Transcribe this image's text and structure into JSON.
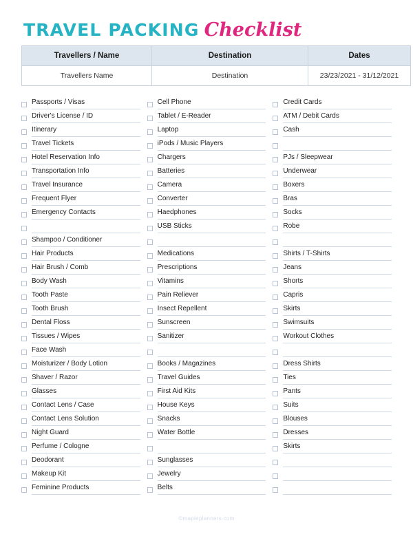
{
  "title": {
    "main": "TRAVEL PACKING",
    "script": "Checklist"
  },
  "colors": {
    "title_main": "#26b3c4",
    "title_script": "#e0277f",
    "table_header_bg": "#dde5ee",
    "rule": "#cfd9e6",
    "checkbox_border": "#b6c3d4",
    "footer_text": "#d3dcea"
  },
  "info_table": {
    "headers": [
      "Travellers / Name",
      "Destination",
      "Dates"
    ],
    "values": [
      "Travellers Name",
      "Destination",
      "23/23/2021 - 31/12/2021"
    ]
  },
  "columns": [
    {
      "items": [
        "Passports / Visas",
        "Driver's License / ID",
        "Itinerary",
        "Travel Tickets",
        "Hotel Reservation Info",
        "Transportation Info",
        "Travel Insurance",
        "Frequent Flyer",
        "Emergency Contacts",
        "",
        "Shampoo / Conditioner",
        "Hair Products",
        "Hair Brush / Comb",
        "Body Wash",
        "Tooth Paste",
        "Tooth Brush",
        "Dental Floss",
        "Tissues / Wipes",
        "Face Wash",
        "Moisturizer / Body Lotion",
        "Shaver / Razor",
        "Glasses",
        "Contact Lens / Case",
        "Contact Lens Solution",
        "Night Guard",
        "Perfume / Cologne",
        "Deodorant",
        "Makeup Kit",
        "Feminine Products"
      ]
    },
    {
      "items": [
        "Cell Phone",
        "Tablet / E-Reader",
        "Laptop",
        "iPods / Music Players",
        "Chargers",
        "Batteries",
        "Camera",
        "Converter",
        "Haedphones",
        "USB Sticks",
        "",
        "Medications",
        "Prescriptions",
        "Vitamins",
        "Pain Reliever",
        "Insect Repellent",
        "Sunscreen",
        "Sanitizer",
        "",
        "Books / Magazines",
        "Travel Guides",
        "First Aid Kits",
        "House Keys",
        "Snacks",
        "Water Bottle",
        "",
        "Sunglasses",
        "Jewelry",
        "Belts"
      ]
    },
    {
      "items": [
        "Credit Cards",
        "ATM / Debit Cards",
        "Cash",
        "",
        "PJs / Sleepwear",
        "Underwear",
        "Boxers",
        "Bras",
        "Socks",
        "Robe",
        "",
        "Shirts / T-Shirts",
        "Jeans",
        "Shorts",
        "Capris",
        "Skirts",
        "Swimsuits",
        "Workout Clothes",
        "",
        "Dress Shirts",
        "Ties",
        "Pants",
        "Suits",
        "Blouses",
        "Dresses",
        "Skirts",
        "",
        "",
        ""
      ]
    }
  ],
  "footer": {
    "credit": "©mapleplanners.com"
  }
}
